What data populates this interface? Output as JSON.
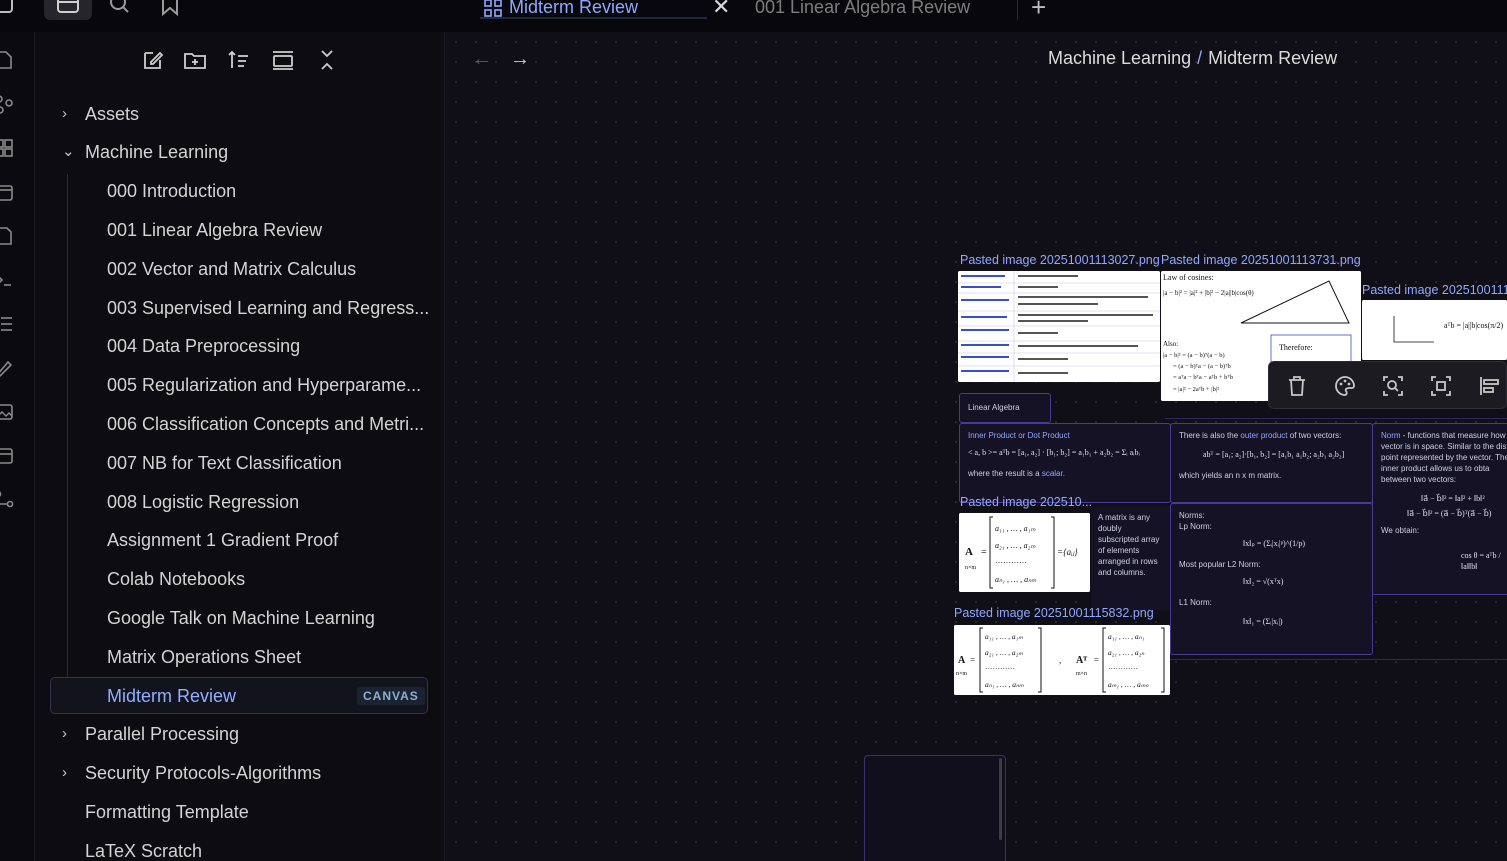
{
  "tabs": {
    "active_label": "Midterm Review",
    "inactive_label": "001 Linear Algebra Review"
  },
  "breadcrumb": {
    "parent": "Machine Learning",
    "current": "Midterm Review"
  },
  "sidebar": {
    "items": [
      {
        "label": "Assets"
      },
      {
        "label": "Machine Learning"
      },
      {
        "label": "000 Introduction"
      },
      {
        "label": "001 Linear Algebra Review"
      },
      {
        "label": "002 Vector and Matrix Calculus"
      },
      {
        "label": "003 Supervised Learning and Regress..."
      },
      {
        "label": "004 Data Preprocessing"
      },
      {
        "label": "005 Regularization and Hyperparame..."
      },
      {
        "label": "006 Classification Concepts and Metri..."
      },
      {
        "label": "007 NB for Text Classification"
      },
      {
        "label": "008 Logistic Regression"
      },
      {
        "label": "Assignment 1 Gradient Proof"
      },
      {
        "label": "Colab Notebooks"
      },
      {
        "label": "Google Talk on Machine Learning"
      },
      {
        "label": "Matrix Operations Sheet"
      },
      {
        "label": "Midterm Review"
      },
      {
        "label": "Parallel Processing"
      },
      {
        "label": "Security Protocols-Algorithms"
      },
      {
        "label": "Formatting Template"
      },
      {
        "label": "LaTeX Scratch"
      }
    ],
    "selected_badge": "CANVAS"
  },
  "canvas": {
    "img1_label": "Pasted image 20251001113027.png",
    "img2_label": "Pasted image 20251001113731.png",
    "img3_label": "Pasted image 2025100111",
    "img4_label": "Pasted image 202510...",
    "img5_label": "Pasted image 20251001115832.png",
    "group_label": "Linear Algebra",
    "inner_title": "Inner Product or Dot Product",
    "inner_result_pre": "where the result is a",
    "inner_result_word": "scalar.",
    "outer_pre": "There is also the",
    "outer_word": "outer product",
    "outer_post": "of two vectors:",
    "outer_yields": "which yields an n x m matrix.",
    "norm_word": "Norm",
    "norm_text": "- functions that measure how vector is in space. Similar to the dist point represented by the vector. The inner product allows us to obta between two vectors:",
    "norm_obtain": "We obtain:",
    "matrix_desc": "A matrix is any doubly subscripted array of elements arranged in rows and columns.",
    "norms_title": "Norms:",
    "lp_norm": "Lp Norm:",
    "l2_norm": "Most popular L2 Norm:",
    "l1_norm": "L1 Norm:",
    "law_of_cosines": "Law of cosines:",
    "also": "Also:",
    "therefore": "Therefore:"
  }
}
